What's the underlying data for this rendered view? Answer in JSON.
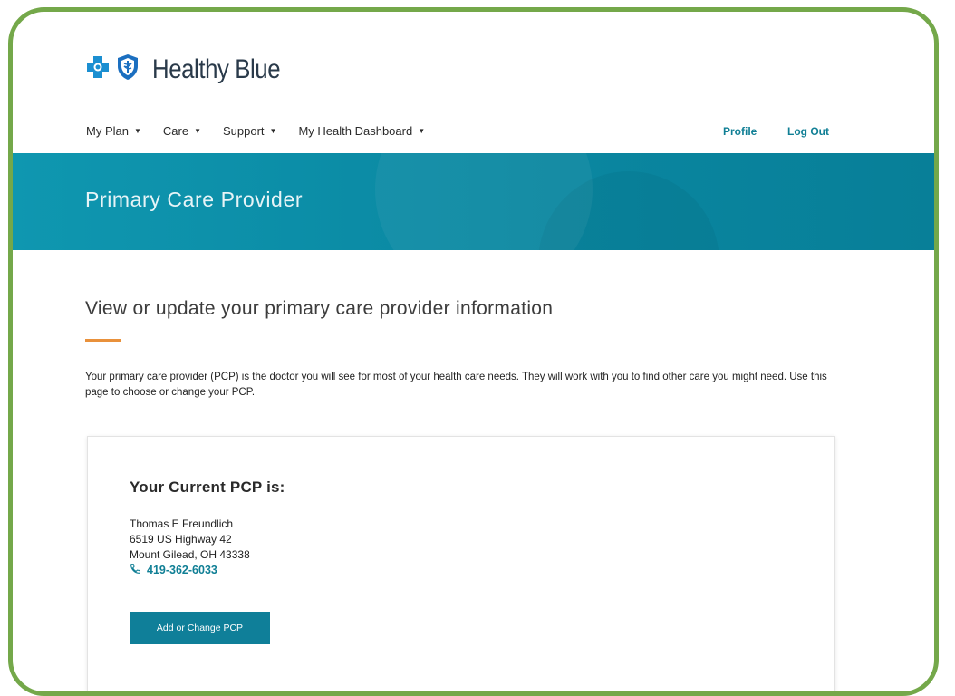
{
  "brand": {
    "name": "Healthy Blue",
    "cross_color": "#1b8fd1",
    "shield_color": "#1b6fc0"
  },
  "nav": {
    "items": [
      {
        "label": "My Plan"
      },
      {
        "label": "Care"
      },
      {
        "label": "Support"
      },
      {
        "label": "My Health Dashboard"
      }
    ],
    "profile_label": "Profile",
    "logout_label": "Log Out"
  },
  "banner": {
    "title": "Primary Care Provider",
    "color": "#0a87a1"
  },
  "main": {
    "subtitle": "View or update your primary care provider information",
    "intro": "Your primary care provider (PCP) is the doctor you will see for most of your health care needs. They will work with you to find other care you might need. Use this page to choose or change your PCP.",
    "accent_color": "#e9913b"
  },
  "card": {
    "title": "Your Current PCP is:",
    "provider_name": "Thomas E Freundlich",
    "address_line1": "6519 US Highway 42",
    "address_line2": "Mount Gilead, OH 43338",
    "phone": "419-362-6033",
    "button_label": "Add or Change PCP"
  },
  "frame_color": "#74a84a"
}
